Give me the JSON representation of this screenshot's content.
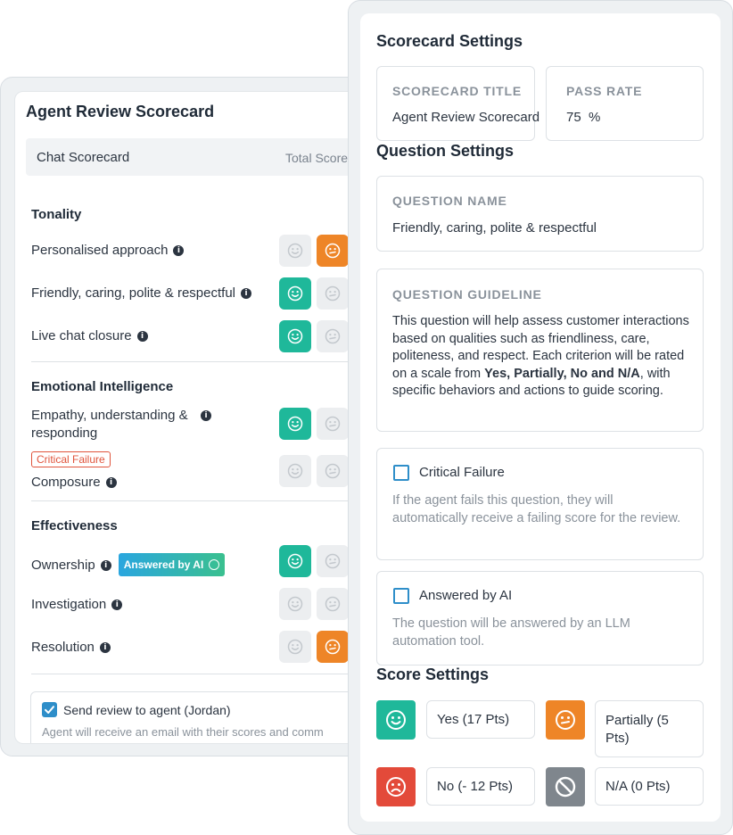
{
  "left": {
    "title": "Agent Review Scorecard",
    "chat_scorecard": "Chat Scorecard",
    "total_score": "Total Score",
    "sections": [
      {
        "name": "Tonality",
        "questions": [
          {
            "label": "Personalised approach",
            "selected": "partially"
          },
          {
            "label": "Friendly, caring, polite & respectful",
            "selected": "yes"
          },
          {
            "label": "Live chat closure",
            "selected": "yes"
          }
        ]
      },
      {
        "name": "Emotional Intelligence",
        "questions": [
          {
            "label": "Empathy, understanding & responding",
            "selected": "yes"
          },
          {
            "label": "Composure",
            "selected": "none",
            "tag": "Critical Failure"
          }
        ]
      },
      {
        "name": "Effectiveness",
        "questions": [
          {
            "label": "Ownership",
            "selected": "yes",
            "badge": "Answered by AI"
          },
          {
            "label": "Investigation",
            "selected": "none"
          },
          {
            "label": "Resolution",
            "selected": "partially"
          }
        ]
      }
    ],
    "send_review": {
      "label": "Send review to agent (Jordan)",
      "checked": true,
      "description": "Agent will receive an email with their scores and comm"
    }
  },
  "right": {
    "title": "Scorecard Settings",
    "scorecard_title": {
      "caption": "SCORECARD TITLE",
      "value": "Agent Review Scorecard"
    },
    "pass_rate": {
      "caption": "PASS RATE",
      "value": "75  %"
    },
    "question_settings": "Question Settings",
    "question_name": {
      "caption": "QUESTION NAME",
      "value": "Friendly, caring, polite & respectful"
    },
    "question_guideline": {
      "caption": "QUESTION GUIDELINE",
      "text_before": "This question will help assess customer interactions based on qualities such as friendliness, care, politeness, and respect. Each criterion will be rated on a scale from ",
      "text_bold": "Yes, Partially, No and N/A",
      "text_after": ", with specific behaviors and actions to guide scoring."
    },
    "critical_failure": {
      "label": "Critical Failure",
      "checked": false,
      "description": "If the agent fails this question, they will automatically receive a failing score for the review."
    },
    "answered_by_ai": {
      "label": "Answered by AI",
      "checked": false,
      "description": "The question will be answered by an LLM automation tool."
    },
    "score_settings": "Score Settings",
    "scores": [
      {
        "icon": "smile-icon",
        "color": "#1fb89a",
        "label": "Yes (17 Pts)"
      },
      {
        "icon": "neutral-face-icon",
        "color": "#ee8527",
        "label": "Partially (5 Pts)"
      },
      {
        "icon": "frown-icon",
        "color": "#e34a3a",
        "label": "No (- 12 Pts)"
      },
      {
        "icon": "prohibited-icon",
        "color": "#7f868d",
        "label": "N/A (0 Pts)"
      }
    ]
  },
  "info_glyph": "i"
}
